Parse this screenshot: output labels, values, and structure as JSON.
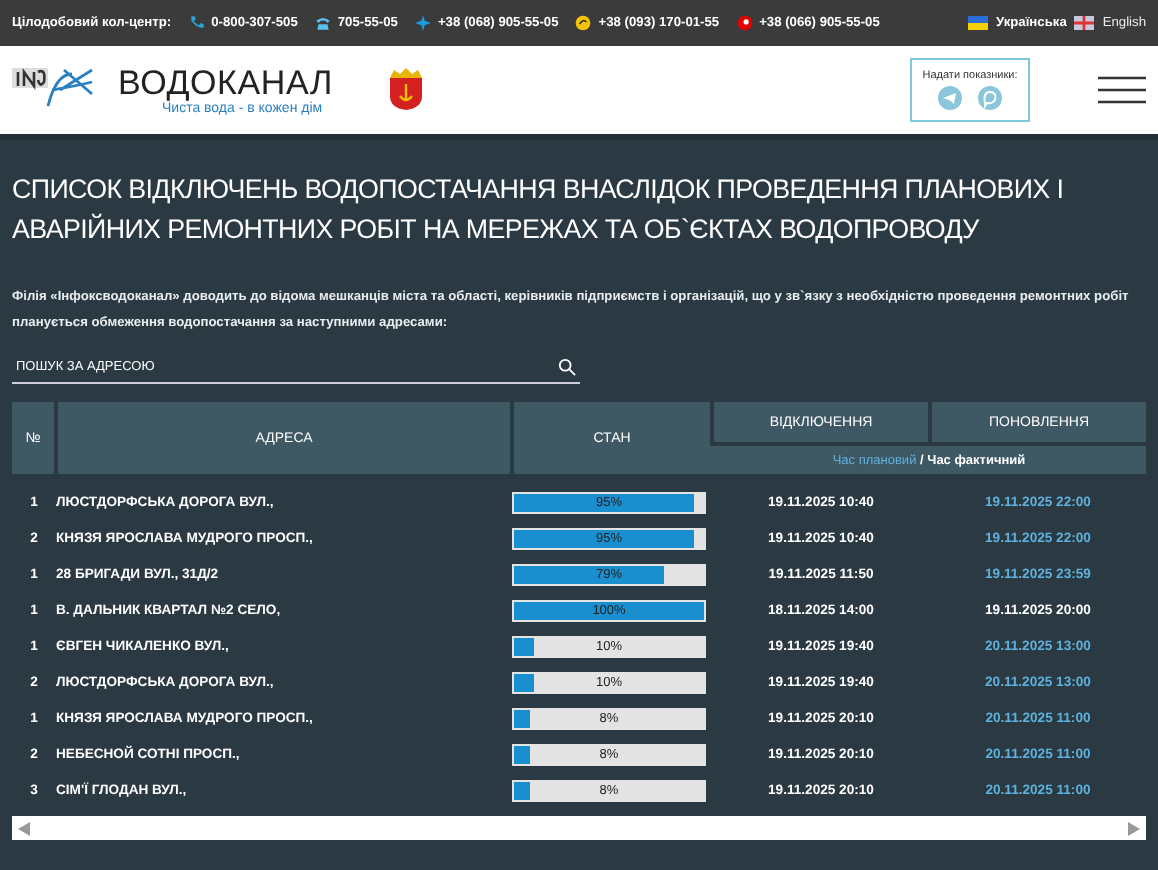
{
  "top_bar": {
    "label": "Цілодобовий кол-центр:",
    "phones": [
      {
        "kind": "phone",
        "number": "0-800-307-505"
      },
      {
        "kind": "landline",
        "number": "705-55-05"
      },
      {
        "kind": "kyivstar",
        "number": "+38 (068) 905-55-05"
      },
      {
        "kind": "lifecell",
        "number": "+38 (093) 170-01-55"
      },
      {
        "kind": "vodafone",
        "number": "+38 (066) 905-55-05"
      }
    ],
    "languages": [
      {
        "label": "Українська",
        "selected": true
      },
      {
        "label": "English",
        "selected": false
      }
    ]
  },
  "header": {
    "logo_text": "ВОДОКАНАЛ",
    "slogan": "Чиста вода - в кожен дім",
    "readings_label": "Надати показники:"
  },
  "title": "СПИСОК ВІДКЛЮЧЕНЬ ВОДОПОСТАЧАННЯ ВНАСЛІДОК ПРОВЕДЕННЯ ПЛАНОВИХ І АВАРІЙНИХ РЕМОНТНИХ РОБІТ НА МЕРЕЖАХ ТА ОБ`ЄКТАХ ВОДОПРОВОДУ",
  "notice": "Філія «Інфоксводоканал» доводить до відома мешканців міста та області, керівників підприємств і організацій, що у зв`язку з необхідністю проведення ремонтних робіт планується обмеження водопостачання за наступними адресами:",
  "search": {
    "placeholder": "ПОШУК ЗА АДРЕСОЮ"
  },
  "table": {
    "columns": [
      "№",
      "АДРЕСА",
      "СТАН",
      "ВІДКЛЮЧЕННЯ",
      "ПОНОВЛЕННЯ"
    ],
    "legend_planned": "Час плановий",
    "legend_separator": " / ",
    "legend_actual": "Час фактичний",
    "rows": [
      {
        "number": "1",
        "address": "ЛЮСТДОРФСЬКА ДОРОГА ВУЛ.,",
        "level": 0.95,
        "percent": "95%",
        "off": "19.11.2025 10:40",
        "on": "19.11.2025 22:00",
        "actual": false
      },
      {
        "number": "2",
        "address": "КНЯЗЯ ЯРОСЛАВА МУДРОГО ПРОСП.,",
        "level": 0.95,
        "percent": "95%",
        "off": "19.11.2025 10:40",
        "on": "19.11.2025 22:00",
        "actual": false
      },
      {
        "number": "1",
        "address": "28 БРИГАДИ ВУЛ., 31Д/2",
        "level": 0.79,
        "percent": "79%",
        "off": "19.11.2025 11:50",
        "on": "19.11.2025 23:59",
        "actual": false
      },
      {
        "number": "1",
        "address": "В. ДАЛЬНИК КВАРТАЛ №2 СЕЛО,",
        "level": 1,
        "percent": "100%",
        "off": "18.11.2025 14:00",
        "on": "19.11.2025 20:00",
        "actual": true
      },
      {
        "number": "1",
        "address": "ЄВГЕН ЧИКАЛЕНКО ВУЛ.,",
        "level": 0.1,
        "percent": "10%",
        "off": "19.11.2025 19:40",
        "on": "20.11.2025 13:00",
        "actual": false
      },
      {
        "number": "2",
        "address": "ЛЮСТДОРФСЬКА ДОРОГА ВУЛ.,",
        "level": 0.1,
        "percent": "10%",
        "off": "19.11.2025 19:40",
        "on": "20.11.2025 13:00",
        "actual": false
      },
      {
        "number": "1",
        "address": "КНЯЗЯ ЯРОСЛАВА МУДРОГО ПРОСП.,",
        "level": 0.08,
        "percent": "8%",
        "off": "19.11.2025 20:10",
        "on": "20.11.2025 11:00",
        "actual": false
      },
      {
        "number": "2",
        "address": "НЕБЕСНОЙ СОТНІ ПРОСП.,",
        "level": 0.08,
        "percent": "8%",
        "off": "19.11.2025 20:10",
        "on": "20.11.2025 11:00",
        "actual": false
      },
      {
        "number": "3",
        "address": "СІМ'Ї ГЛОДАН ВУЛ.,",
        "level": 0.08,
        "percent": "8%",
        "off": "19.11.2025 20:10",
        "on": "20.11.2025 11:00",
        "actual": false
      }
    ]
  }
}
